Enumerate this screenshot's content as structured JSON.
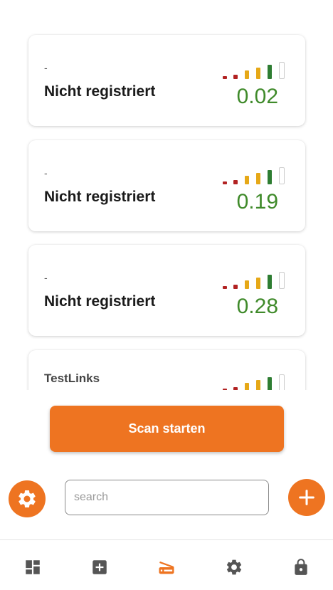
{
  "devices": [
    {
      "subtitle": "-",
      "name": "Nicht registriert",
      "value": "0.02"
    },
    {
      "subtitle": "-",
      "name": "Nicht registriert",
      "value": "0.19"
    },
    {
      "subtitle": "-",
      "name": "Nicht registriert",
      "value": "0.28"
    },
    {
      "subtitle": "",
      "name": "TestLinks",
      "value": ""
    }
  ],
  "signal_colors": {
    "weak": "#b22222",
    "medium": "#e6a817",
    "strong": "#2e7d32"
  },
  "actions": {
    "scan_label": "Scan starten"
  },
  "search": {
    "placeholder": "search",
    "value": ""
  },
  "icons": {
    "settings_fab": "gear-icon",
    "add_fab": "plus-icon",
    "nav": [
      "dashboard-icon",
      "add-box-icon",
      "scanner-icon",
      "gear-icon",
      "lock-icon"
    ]
  },
  "colors": {
    "accent": "#ee7421",
    "value_green": "#3f8a2a",
    "nav_icon": "#555555"
  },
  "nav": {
    "active_index": 2
  }
}
